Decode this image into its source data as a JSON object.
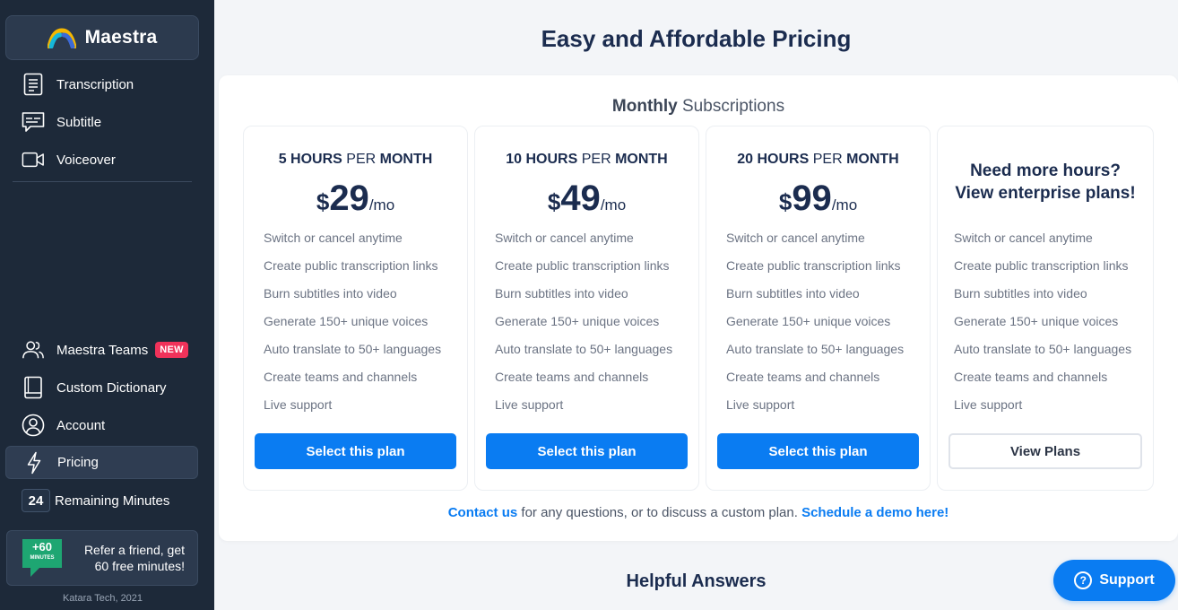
{
  "sidebar": {
    "brand": "Maestra",
    "nav_top": [
      {
        "label": "Transcription",
        "icon": "document-icon"
      },
      {
        "label": "Subtitle",
        "icon": "subtitle-icon"
      },
      {
        "label": "Voiceover",
        "icon": "video-camera-icon"
      }
    ],
    "nav_bottom": [
      {
        "label": "Maestra Teams",
        "icon": "users-icon",
        "badge": "NEW"
      },
      {
        "label": "Custom Dictionary",
        "icon": "book-icon"
      },
      {
        "label": "Account",
        "icon": "user-circle-icon"
      },
      {
        "label": "Pricing",
        "icon": "lightning-icon",
        "active": true
      }
    ],
    "remaining": {
      "value": "24",
      "label": "Remaining Minutes"
    },
    "refer": {
      "badge_top": "+60",
      "badge_bottom": "MINUTES",
      "text": "Refer a friend, get 60 free minutes!"
    },
    "copyright": "Katara Tech, 2021"
  },
  "main": {
    "title": "Easy and Affordable Pricing",
    "subtitle_bold": "Monthly",
    "subtitle_rest": " Subscriptions",
    "plans": [
      {
        "hours": "5 HOURS",
        "per": " PER ",
        "month": "MONTH",
        "currency": "$",
        "price": "29",
        "period": "/mo",
        "button": "Select this plan"
      },
      {
        "hours": "10 HOURS",
        "per": " PER ",
        "month": "MONTH",
        "currency": "$",
        "price": "49",
        "period": "/mo",
        "button": "Select this plan"
      },
      {
        "hours": "20 HOURS",
        "per": " PER ",
        "month": "MONTH",
        "currency": "$",
        "price": "99",
        "period": "/mo",
        "button": "Select this plan"
      }
    ],
    "enterprise": {
      "line1": "Need more hours?",
      "line2": "View enterprise plans!",
      "button": "View Plans"
    },
    "features": [
      "Switch or cancel anytime",
      "Create public transcription links",
      "Burn subtitles into video",
      "Generate 150+ unique voices",
      "Auto translate to 50+ languages",
      "Create teams and channels",
      "Live support"
    ],
    "contact": {
      "link1": "Contact us",
      "middle": " for any questions, or to discuss a custom plan. ",
      "link2": "Schedule a demo here!"
    },
    "helpful": "Helpful Answers",
    "support": "Support"
  },
  "colors": {
    "accent": "#0a7cf2",
    "sidebar_bg": "#1d2939",
    "new_badge": "#f0325a",
    "refer_green": "#1ea672"
  }
}
